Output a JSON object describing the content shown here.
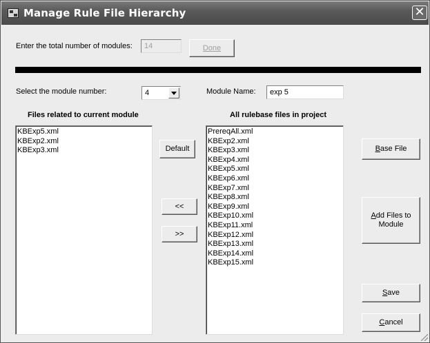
{
  "window": {
    "title": "Manage Rule File Hierarchy",
    "close_glyph": "✕"
  },
  "modules": {
    "total_label": "Enter the total number of modules:",
    "total_value": "14",
    "done_label": "Done",
    "select_label": "Select the module number:",
    "selected_number": "4",
    "name_label": "Module Name:",
    "name_value": "exp 5"
  },
  "left_panel": {
    "heading": "Files related to current module",
    "files": [
      "KBExp5.xml",
      "KBExp2.xml",
      "KBExp3.xml"
    ]
  },
  "right_panel": {
    "heading": "All rulebase files in project",
    "files": [
      "PrereqAll.xml",
      "KBExp2.xml",
      "KBExp3.xml",
      "KBExp4.xml",
      "KBExp5.xml",
      "KBExp6.xml",
      "KBExp7.xml",
      "KBExp8.xml",
      "KBExp9.xml",
      "KBExp10.xml",
      "KBExp11.xml",
      "KBExp12.xml",
      "KBExp13.xml",
      "KBExp14.xml",
      "KBExp15.xml"
    ]
  },
  "buttons": {
    "default": "Default",
    "move_left": "<<",
    "move_right": ">>",
    "base_file_mn": "B",
    "base_file_rest": "ase File",
    "add_files_mn": "A",
    "add_files_rest": "dd Files to Module",
    "save_mn": "S",
    "save_rest": "ave",
    "cancel_mn": "C",
    "cancel_rest": "ancel"
  },
  "icons": {
    "app": "rule-hierarchy-app-icon",
    "close": "close-icon"
  }
}
